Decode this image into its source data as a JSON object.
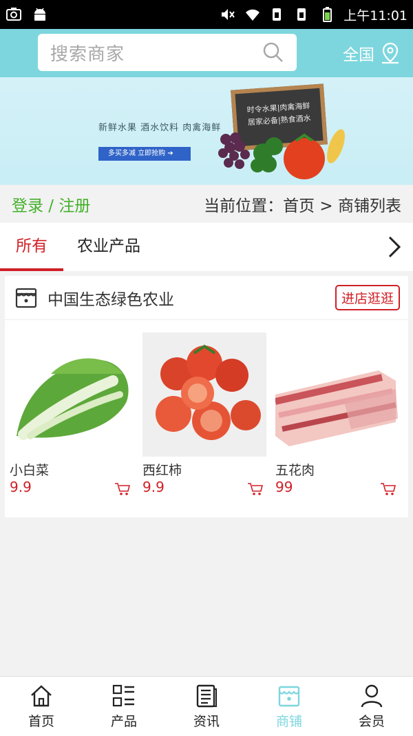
{
  "statusbar": {
    "time": "上午11:01"
  },
  "header": {
    "search_placeholder": "搜索商家",
    "region_label": "全国"
  },
  "banner": {
    "tagline": "新鲜水果  酒水饮料  肉禽海鲜",
    "button_label": "多买多减 立即抢购 ➔",
    "board_line1": "时令水果|肉禽海鲜",
    "board_line2": "居家必备|熟食酒水"
  },
  "location": {
    "login_label": "登录 / 注册",
    "breadcrumb": "当前位置：首页 > 商铺列表"
  },
  "tabs": [
    {
      "label": "所有",
      "active": true
    },
    {
      "label": "农业产品",
      "active": false
    }
  ],
  "store": {
    "name": "中国生态绿色农业",
    "enter_label": "进店逛逛",
    "products": [
      {
        "name": "小白菜",
        "price": "9.9"
      },
      {
        "name": "西红柿",
        "price": "9.9"
      },
      {
        "name": "五花肉",
        "price": "99"
      }
    ]
  },
  "bottom_nav": [
    {
      "label": "首页",
      "icon": "home-icon",
      "active": false
    },
    {
      "label": "产品",
      "icon": "grid-list-icon",
      "active": false
    },
    {
      "label": "资讯",
      "icon": "news-icon",
      "active": false
    },
    {
      "label": "商铺",
      "icon": "store-icon",
      "active": true
    },
    {
      "label": "会员",
      "icon": "user-icon",
      "active": false
    }
  ],
  "colors": {
    "accent": "#7dd6de",
    "red": "#d01f26",
    "green": "#43b02a"
  }
}
